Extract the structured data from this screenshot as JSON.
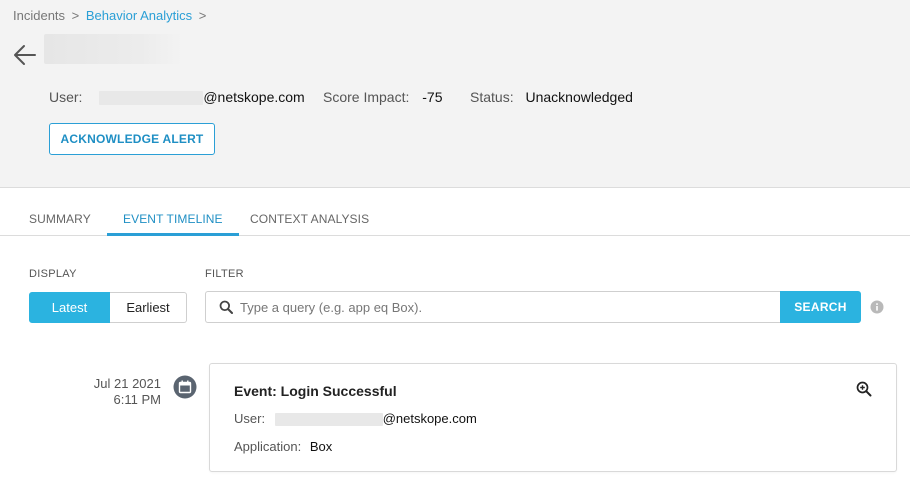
{
  "breadcrumb": {
    "items": [
      "Incidents",
      "Behavior Analytics"
    ],
    "separator": ">"
  },
  "alert": {
    "user_label": "User:",
    "user_domain": "@netskope.com",
    "score_label": "Score Impact:",
    "score_value": "-75",
    "status_label": "Status:",
    "status_value": "Unacknowledged",
    "acknowledge_button": "ACKNOWLEDGE ALERT"
  },
  "tabs": [
    {
      "label": "SUMMARY",
      "active": false
    },
    {
      "label": "EVENT TIMELINE",
      "active": true
    },
    {
      "label": "CONTEXT ANALYSIS",
      "active": false
    }
  ],
  "display": {
    "label": "DISPLAY",
    "options": [
      "Latest",
      "Earliest"
    ],
    "selected": "Latest"
  },
  "filter": {
    "label": "FILTER",
    "placeholder": "Type a query (e.g. app eq Box).",
    "value": "",
    "search_button": "SEARCH"
  },
  "events": [
    {
      "date": "Jul 21 2021",
      "time": "6:11 PM",
      "title": "Event: Login Successful",
      "user_label": "User:",
      "user_domain": "@netskope.com",
      "application_label": "Application:",
      "application_value": "Box"
    }
  ],
  "colors": {
    "accent": "#2bb3e0",
    "link": "#2a9fd6",
    "header_bg": "#f3f3f3"
  },
  "icons": {
    "back": "arrow-left-icon",
    "search": "search-icon",
    "info": "info-icon",
    "calendar": "calendar-icon",
    "zoom": "zoom-in-icon"
  }
}
